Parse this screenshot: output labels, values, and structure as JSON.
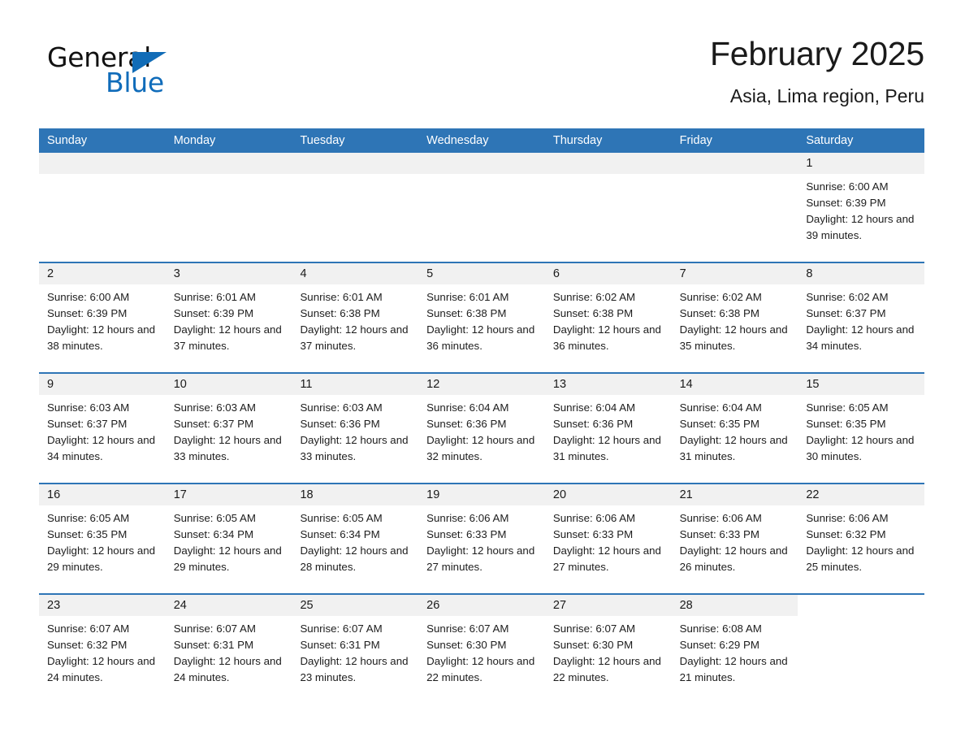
{
  "brand": {
    "name_part1": "General",
    "name_part2": "Blue",
    "flag_icon": "triangle-flag-icon",
    "accent_color": "#116CB7"
  },
  "header": {
    "month_title": "February 2025",
    "location": "Asia, Lima region, Peru"
  },
  "calendar": {
    "header_color": "#2E75B6",
    "day_strip_color": "#F1F1F1",
    "weekdays": [
      "Sunday",
      "Monday",
      "Tuesday",
      "Wednesday",
      "Thursday",
      "Friday",
      "Saturday"
    ],
    "weeks": [
      [
        {
          "day": "",
          "empty": true
        },
        {
          "day": "",
          "empty": true
        },
        {
          "day": "",
          "empty": true
        },
        {
          "day": "",
          "empty": true
        },
        {
          "day": "",
          "empty": true
        },
        {
          "day": "",
          "empty": true
        },
        {
          "day": "1",
          "sunrise": "Sunrise: 6:00 AM",
          "sunset": "Sunset: 6:39 PM",
          "daylight": "Daylight: 12 hours and 39 minutes."
        }
      ],
      [
        {
          "day": "2",
          "sunrise": "Sunrise: 6:00 AM",
          "sunset": "Sunset: 6:39 PM",
          "daylight": "Daylight: 12 hours and 38 minutes."
        },
        {
          "day": "3",
          "sunrise": "Sunrise: 6:01 AM",
          "sunset": "Sunset: 6:39 PM",
          "daylight": "Daylight: 12 hours and 37 minutes."
        },
        {
          "day": "4",
          "sunrise": "Sunrise: 6:01 AM",
          "sunset": "Sunset: 6:38 PM",
          "daylight": "Daylight: 12 hours and 37 minutes."
        },
        {
          "day": "5",
          "sunrise": "Sunrise: 6:01 AM",
          "sunset": "Sunset: 6:38 PM",
          "daylight": "Daylight: 12 hours and 36 minutes."
        },
        {
          "day": "6",
          "sunrise": "Sunrise: 6:02 AM",
          "sunset": "Sunset: 6:38 PM",
          "daylight": "Daylight: 12 hours and 36 minutes."
        },
        {
          "day": "7",
          "sunrise": "Sunrise: 6:02 AM",
          "sunset": "Sunset: 6:38 PM",
          "daylight": "Daylight: 12 hours and 35 minutes."
        },
        {
          "day": "8",
          "sunrise": "Sunrise: 6:02 AM",
          "sunset": "Sunset: 6:37 PM",
          "daylight": "Daylight: 12 hours and 34 minutes."
        }
      ],
      [
        {
          "day": "9",
          "sunrise": "Sunrise: 6:03 AM",
          "sunset": "Sunset: 6:37 PM",
          "daylight": "Daylight: 12 hours and 34 minutes."
        },
        {
          "day": "10",
          "sunrise": "Sunrise: 6:03 AM",
          "sunset": "Sunset: 6:37 PM",
          "daylight": "Daylight: 12 hours and 33 minutes."
        },
        {
          "day": "11",
          "sunrise": "Sunrise: 6:03 AM",
          "sunset": "Sunset: 6:36 PM",
          "daylight": "Daylight: 12 hours and 33 minutes."
        },
        {
          "day": "12",
          "sunrise": "Sunrise: 6:04 AM",
          "sunset": "Sunset: 6:36 PM",
          "daylight": "Daylight: 12 hours and 32 minutes."
        },
        {
          "day": "13",
          "sunrise": "Sunrise: 6:04 AM",
          "sunset": "Sunset: 6:36 PM",
          "daylight": "Daylight: 12 hours and 31 minutes."
        },
        {
          "day": "14",
          "sunrise": "Sunrise: 6:04 AM",
          "sunset": "Sunset: 6:35 PM",
          "daylight": "Daylight: 12 hours and 31 minutes."
        },
        {
          "day": "15",
          "sunrise": "Sunrise: 6:05 AM",
          "sunset": "Sunset: 6:35 PM",
          "daylight": "Daylight: 12 hours and 30 minutes."
        }
      ],
      [
        {
          "day": "16",
          "sunrise": "Sunrise: 6:05 AM",
          "sunset": "Sunset: 6:35 PM",
          "daylight": "Daylight: 12 hours and 29 minutes."
        },
        {
          "day": "17",
          "sunrise": "Sunrise: 6:05 AM",
          "sunset": "Sunset: 6:34 PM",
          "daylight": "Daylight: 12 hours and 29 minutes."
        },
        {
          "day": "18",
          "sunrise": "Sunrise: 6:05 AM",
          "sunset": "Sunset: 6:34 PM",
          "daylight": "Daylight: 12 hours and 28 minutes."
        },
        {
          "day": "19",
          "sunrise": "Sunrise: 6:06 AM",
          "sunset": "Sunset: 6:33 PM",
          "daylight": "Daylight: 12 hours and 27 minutes."
        },
        {
          "day": "20",
          "sunrise": "Sunrise: 6:06 AM",
          "sunset": "Sunset: 6:33 PM",
          "daylight": "Daylight: 12 hours and 27 minutes."
        },
        {
          "day": "21",
          "sunrise": "Sunrise: 6:06 AM",
          "sunset": "Sunset: 6:33 PM",
          "daylight": "Daylight: 12 hours and 26 minutes."
        },
        {
          "day": "22",
          "sunrise": "Sunrise: 6:06 AM",
          "sunset": "Sunset: 6:32 PM",
          "daylight": "Daylight: 12 hours and 25 minutes."
        }
      ],
      [
        {
          "day": "23",
          "sunrise": "Sunrise: 6:07 AM",
          "sunset": "Sunset: 6:32 PM",
          "daylight": "Daylight: 12 hours and 24 minutes."
        },
        {
          "day": "24",
          "sunrise": "Sunrise: 6:07 AM",
          "sunset": "Sunset: 6:31 PM",
          "daylight": "Daylight: 12 hours and 24 minutes."
        },
        {
          "day": "25",
          "sunrise": "Sunrise: 6:07 AM",
          "sunset": "Sunset: 6:31 PM",
          "daylight": "Daylight: 12 hours and 23 minutes."
        },
        {
          "day": "26",
          "sunrise": "Sunrise: 6:07 AM",
          "sunset": "Sunset: 6:30 PM",
          "daylight": "Daylight: 12 hours and 22 minutes."
        },
        {
          "day": "27",
          "sunrise": "Sunrise: 6:07 AM",
          "sunset": "Sunset: 6:30 PM",
          "daylight": "Daylight: 12 hours and 22 minutes."
        },
        {
          "day": "28",
          "sunrise": "Sunrise: 6:08 AM",
          "sunset": "Sunset: 6:29 PM",
          "daylight": "Daylight: 12 hours and 21 minutes."
        },
        {
          "day": "",
          "empty": true,
          "blank": true
        }
      ]
    ]
  }
}
